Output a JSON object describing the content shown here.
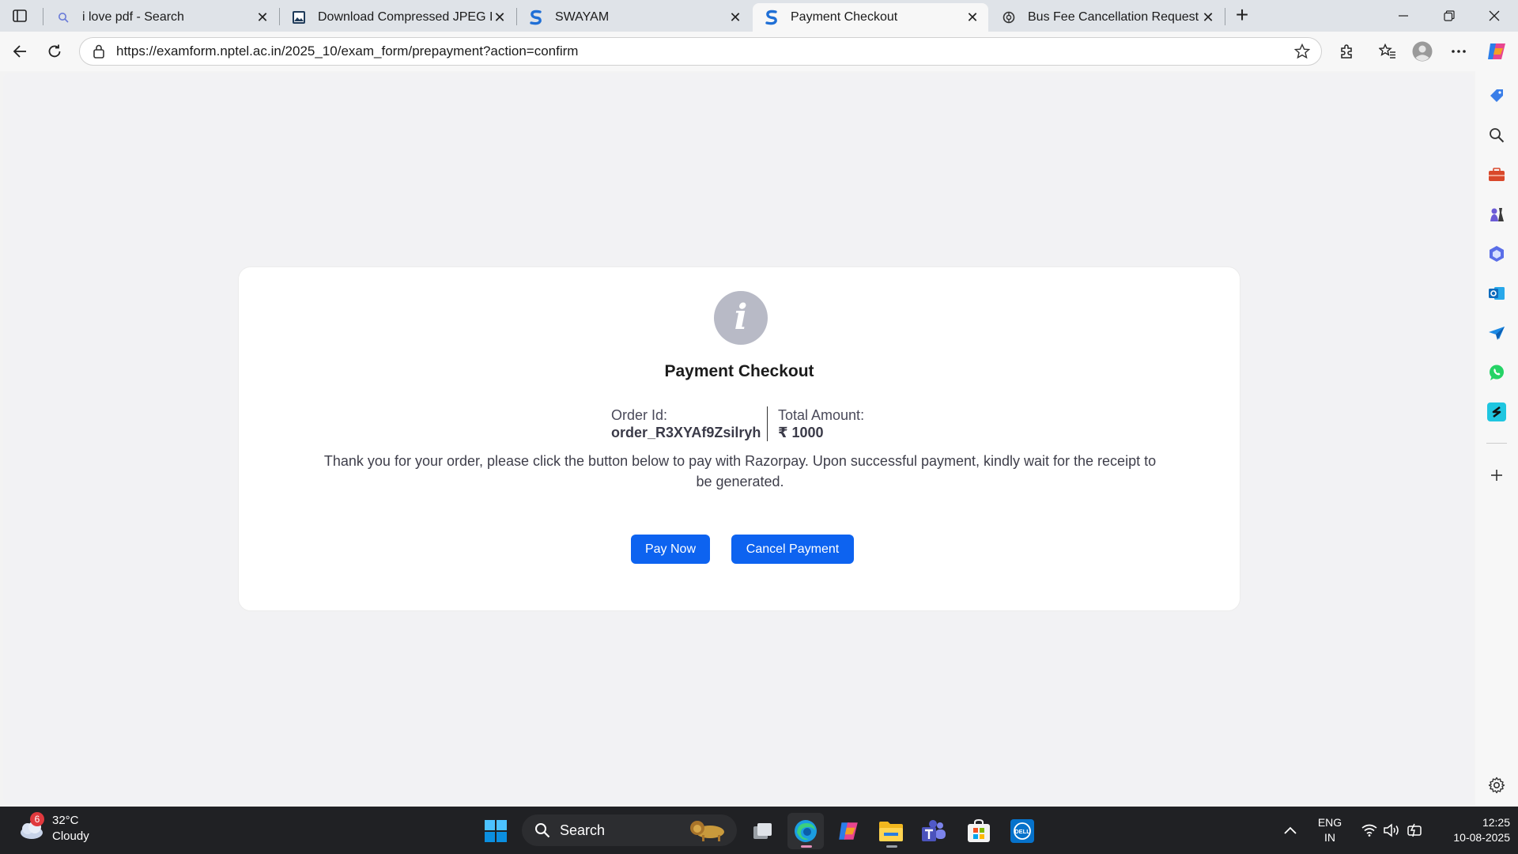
{
  "browser": {
    "tabs": [
      {
        "title": "i love pdf - Search",
        "icon": "search-icon",
        "active": false
      },
      {
        "title": "Download Compressed JPEG Ima",
        "icon": "image-icon",
        "active": false
      },
      {
        "title": "SWAYAM",
        "icon": "swayam-logo-icon",
        "active": false
      },
      {
        "title": "Payment Checkout",
        "icon": "swayam-logo-icon",
        "active": true
      },
      {
        "title": "Bus Fee Cancellation Request",
        "icon": "openai-icon",
        "active": false
      }
    ],
    "url": "https://examform.nptel.ac.in/2025_10/exam_form/prepayment?action=confirm"
  },
  "page": {
    "title": "Payment Checkout",
    "order_label": "Order Id:",
    "order_id": "order_R3XYAf9Zsilryh",
    "amount_label": "Total Amount:",
    "amount": "₹ 1000",
    "message": "Thank you for your order, please click the button below to pay with Razorpay. Upon successful payment, kindly wait for the receipt to be generated.",
    "pay_button": "Pay Now",
    "cancel_button": "Cancel Payment",
    "accent_color": "#0d63f0"
  },
  "taskbar": {
    "weather": {
      "temp": "32°C",
      "condition": "Cloudy",
      "badge": "6"
    },
    "search_label": "Search",
    "language": {
      "line1": "ENG",
      "line2": "IN"
    },
    "time": "12:25",
    "date": "10-08-2025"
  }
}
